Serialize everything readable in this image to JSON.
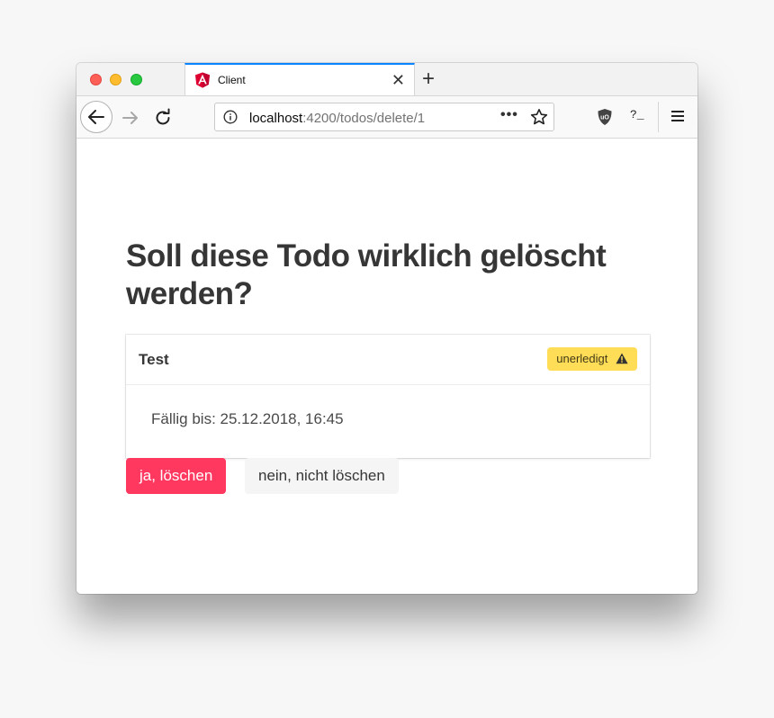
{
  "browser": {
    "tab": {
      "title": "Client",
      "favicon": "angular-icon",
      "close_symbol": "✕"
    },
    "new_tab_symbol": "+",
    "url": {
      "host": "localhost",
      "path": ":4200/todos/delete/1"
    },
    "page_actions_symbol": "•••",
    "extension_prompt": "?_",
    "colors": {
      "tab_accent": "#0a84ff",
      "traffic_close": "#fe5f57",
      "traffic_minimize": "#febc2e",
      "traffic_maximize": "#28c840"
    }
  },
  "page": {
    "heading": "Soll diese Todo wirklich gelöscht werden?",
    "todo": {
      "title": "Test",
      "status_label": "unerledigt",
      "status_icon": "warning-icon",
      "due_text": "Fällig bis: 25.12.2018, 16:45"
    },
    "buttons": {
      "confirm_label": "ja, löschen",
      "cancel_label": "nein, nicht löschen"
    },
    "colors": {
      "danger": "#ff3860",
      "warning": "#ffdd57",
      "heading": "#363636"
    }
  }
}
